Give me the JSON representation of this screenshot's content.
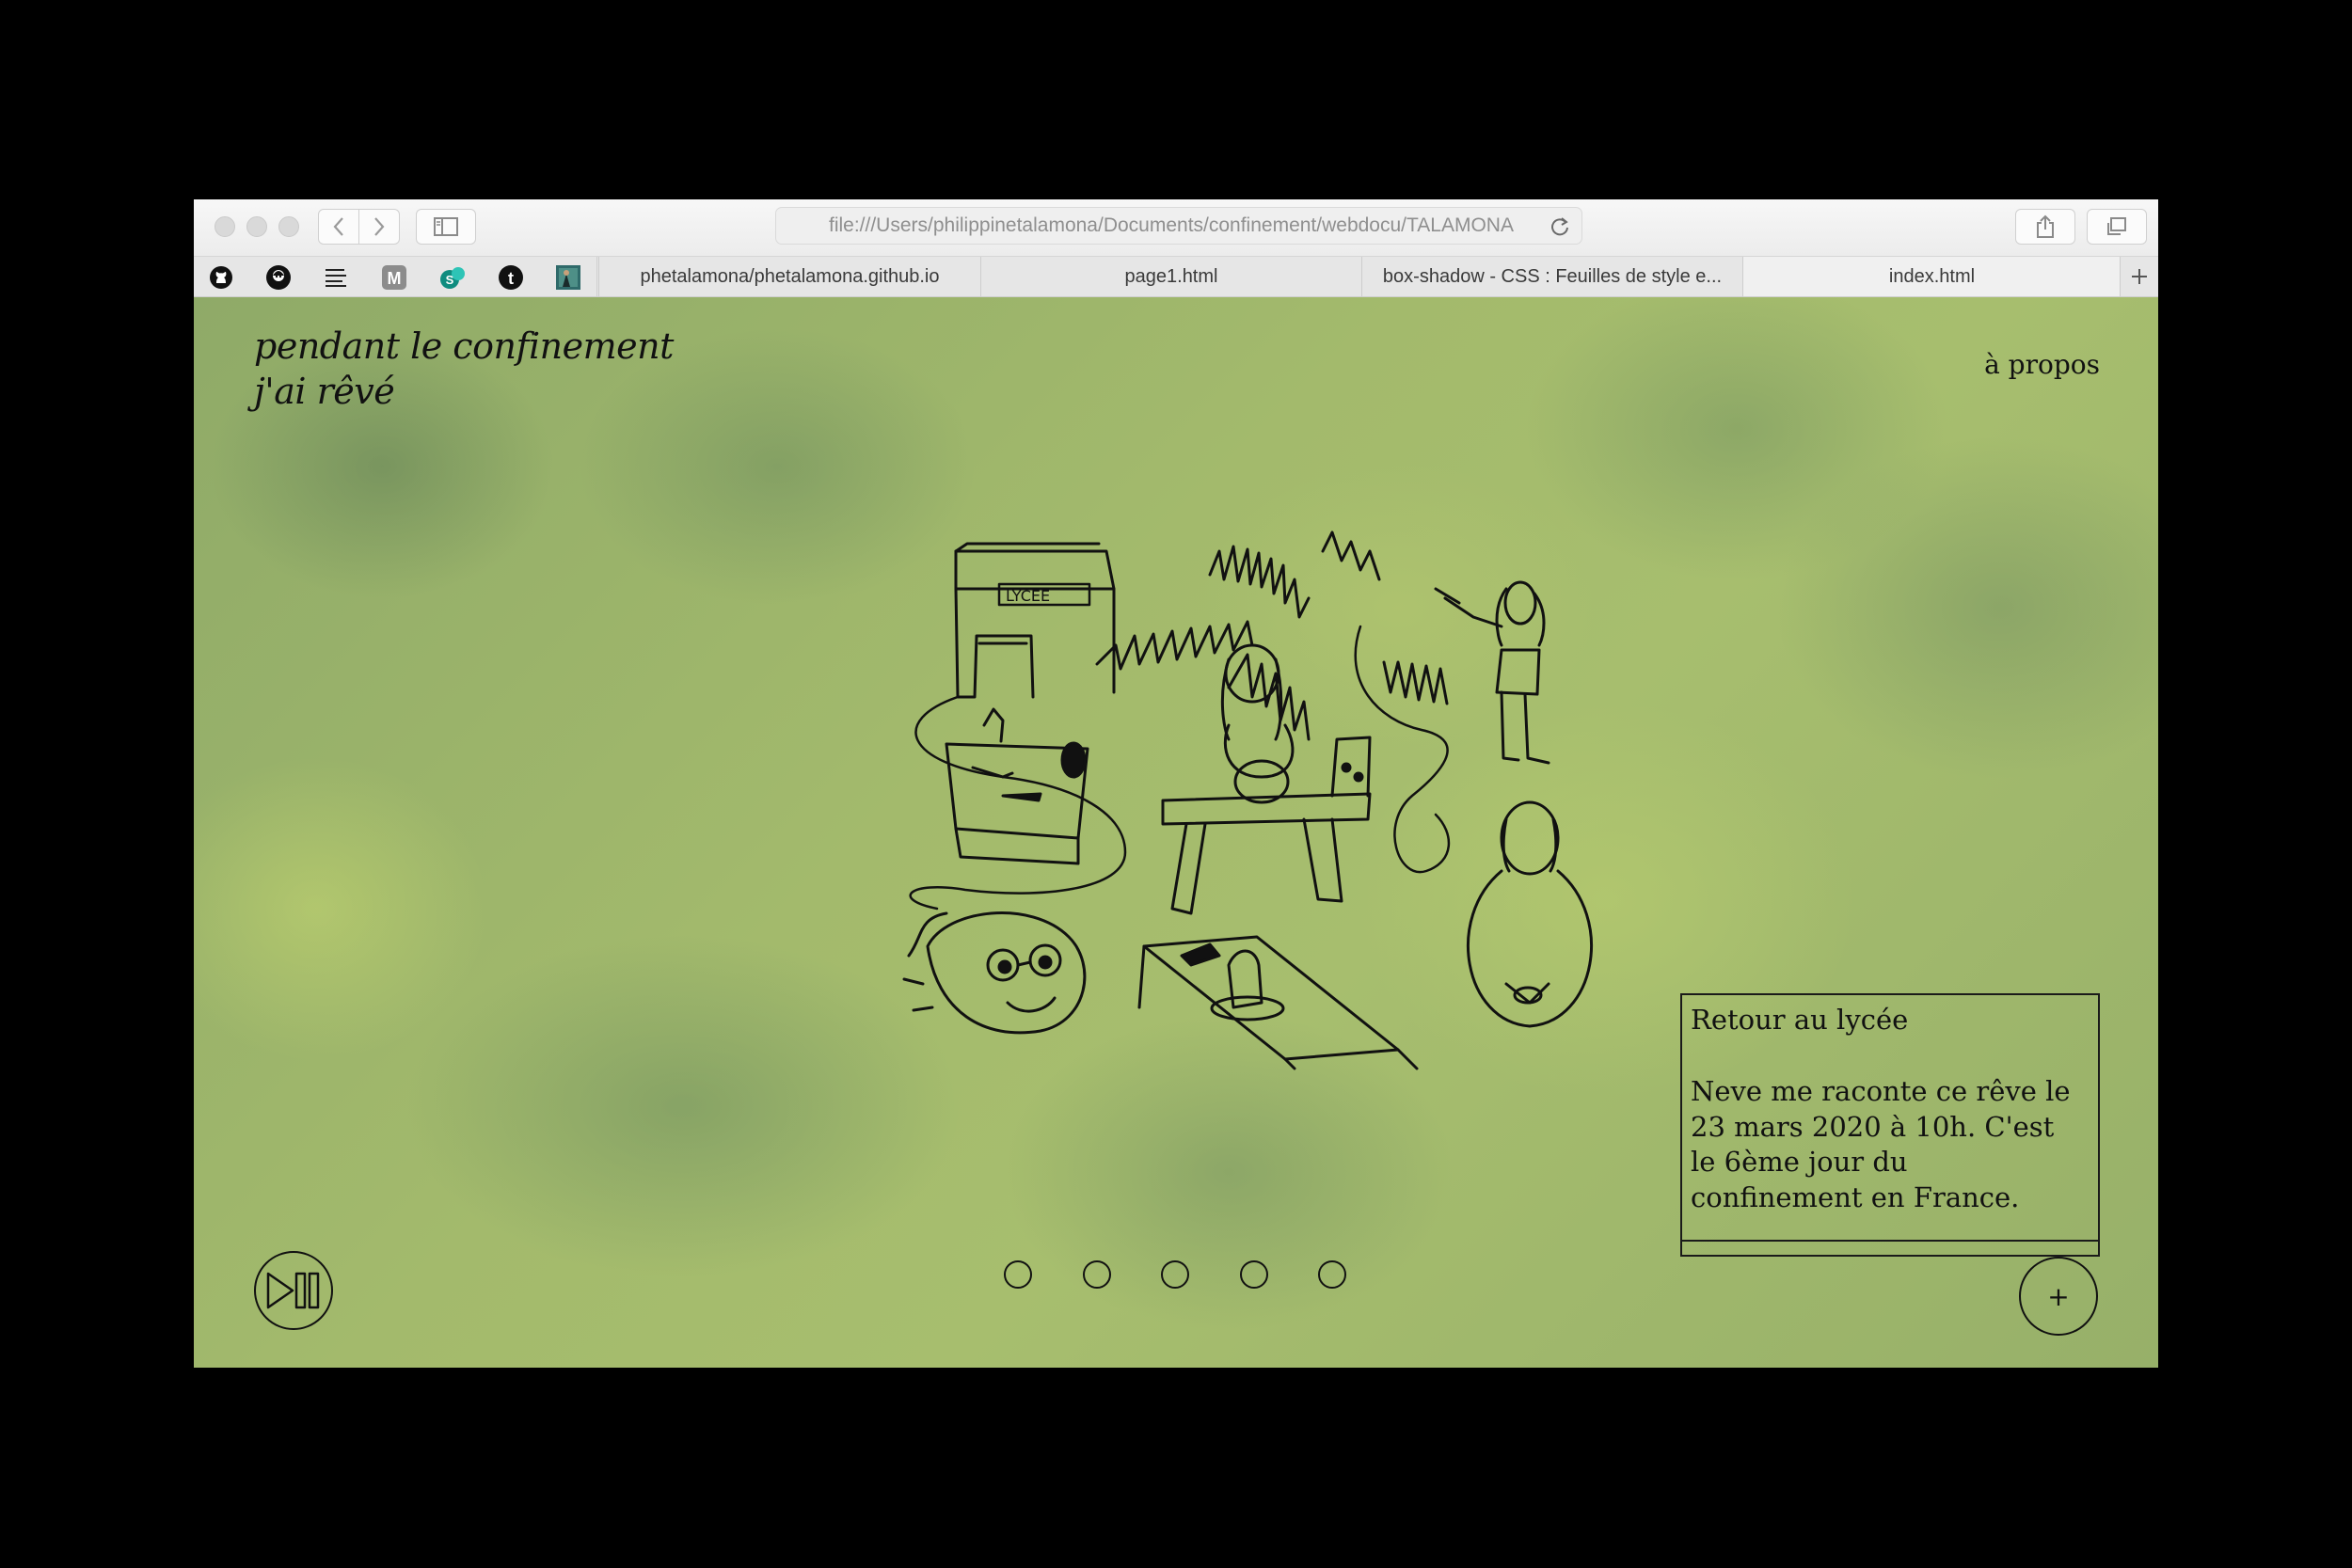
{
  "browser": {
    "address_bar": "file:///Users/philippinetalamona/Documents/confinement/webdocu/TALAMONA",
    "favorites": [
      {
        "icon": "github-icon"
      },
      {
        "icon": "avatar-icon"
      },
      {
        "icon": "list-icon"
      },
      {
        "icon": "m-icon",
        "letter": "M"
      },
      {
        "icon": "s-icon",
        "letter": "S"
      },
      {
        "icon": "tumblr-icon",
        "letter": "t"
      },
      {
        "icon": "image-thumb-icon"
      }
    ],
    "tabs": [
      {
        "label": "phetalamona/phetalamona.github.io"
      },
      {
        "label": "page1.html"
      },
      {
        "label": "box-shadow - CSS : Feuilles de style e..."
      },
      {
        "label": "index.html"
      }
    ]
  },
  "site": {
    "title_line1": "pendant le confinement",
    "title_line2": "j'ai rêvé",
    "about_link": "à propos"
  },
  "dream": {
    "title": "Retour au lycée",
    "text": "Neve me raconte ce rêve le 23 mars 2020 à 10h. C'est le 6ème jour du confinement en France.",
    "drawing_label": "LYCEE"
  },
  "controls": {
    "plus_label": "+",
    "dots": 5
  }
}
